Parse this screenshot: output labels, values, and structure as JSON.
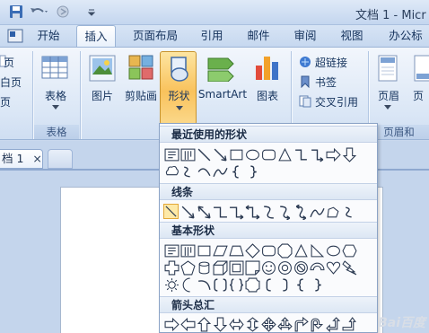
{
  "title": "文档 1 - Micr",
  "tabs": [
    "开始",
    "插入",
    "页面布局",
    "引用",
    "邮件",
    "审阅",
    "视图",
    "办公标"
  ],
  "ribbon": {
    "left_items": [
      "页",
      "白页",
      "页"
    ],
    "table_button": "表格",
    "table_group": "表格",
    "picture_button": "图片",
    "clipart_button": "剪贴画",
    "shapes_button": "形状",
    "smartart_button": "SmartArt",
    "chart_button": "图表",
    "hyperlink": "超链接",
    "bookmark": "书签",
    "crossref": "交叉引用",
    "header_button": "页眉",
    "footer_button": "页",
    "header_group": "页眉和"
  },
  "document": {
    "tab_label": "档 1",
    "close_glyph": "×"
  },
  "shapes_menu": {
    "sections": [
      {
        "title": "最近使用的形状"
      },
      {
        "title": "线条"
      },
      {
        "title": "基本形状"
      },
      {
        "title": "箭头总汇"
      }
    ]
  },
  "watermark": "Bai百度"
}
